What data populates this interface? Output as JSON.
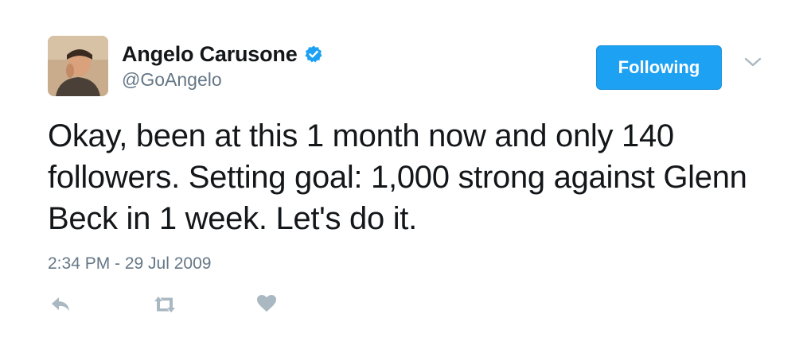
{
  "author": {
    "display_name": "Angelo Carusone",
    "handle": "@GoAngelo",
    "verified": true,
    "avatar_icon": "user-avatar-photo"
  },
  "follow_button": {
    "label": "Following"
  },
  "menu": {
    "icon": "chevron-down-icon"
  },
  "tweet": {
    "text": "Okay, been at this 1 month now and only 140 followers. Setting goal: 1,000 strong against Glenn Beck in 1 week. Let's do it.",
    "timestamp": "2:34 PM - 29 Jul 2009"
  },
  "actions": [
    {
      "icon": "reply-icon"
    },
    {
      "icon": "retweet-icon"
    },
    {
      "icon": "like-heart-icon"
    }
  ],
  "colors": {
    "accent": "#1da1f2",
    "text": "#14171a",
    "secondary_text": "#657786",
    "action_icon": "#aab8c2"
  }
}
